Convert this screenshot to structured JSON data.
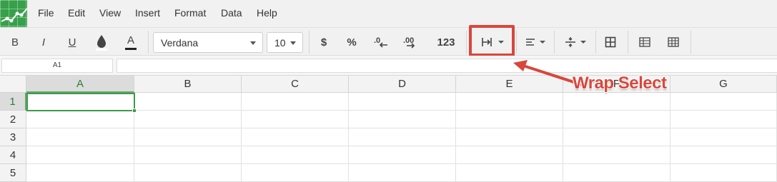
{
  "menu": [
    "File",
    "Edit",
    "View",
    "Insert",
    "Format",
    "Data",
    "Help"
  ],
  "toolbar": {
    "bold": "B",
    "italic": "I",
    "underline": "U",
    "text_color": "A",
    "font_family": "Verdana",
    "font_size": "10",
    "currency": "$",
    "percent": "%",
    "more_formats": "123"
  },
  "formula_bar": {
    "cell_ref": "A1",
    "value": ""
  },
  "grid": {
    "columns": [
      "A",
      "B",
      "C",
      "D",
      "E",
      "F",
      "G"
    ],
    "rows": [
      "1",
      "2",
      "3",
      "4",
      "5"
    ],
    "active_column": "A",
    "active_row": "1"
  },
  "annotation": {
    "label": "Wrap Select",
    "color": "#d9463b"
  },
  "colors": {
    "brand": "#37a04a",
    "selection": "#3d9a4a"
  }
}
